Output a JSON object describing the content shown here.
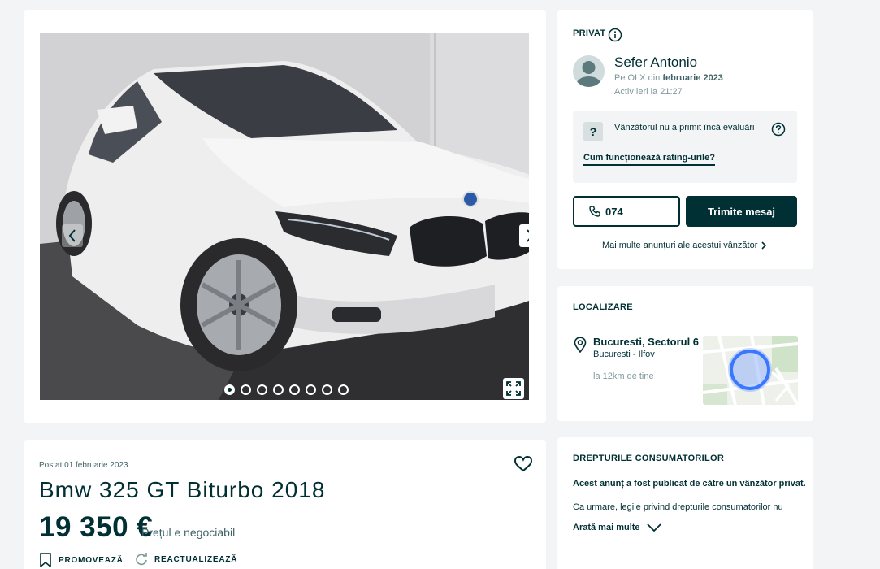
{
  "gallery": {
    "image_alt": "White BMW 3 Series GT photo",
    "image_count": 8,
    "active_index": 0,
    "icons": {
      "prev": "chevron-left-icon",
      "next": "chevron-right-icon",
      "expand": "expand-icon"
    }
  },
  "ad": {
    "posted": "Postat 01 februarie 2023",
    "title": "Bmw 325 GT Biturbo 2018",
    "price": "19 350 €",
    "negotiable": "Prețul e negociabil",
    "actions": {
      "promote": "PROMOVEAZĂ",
      "refresh": "REACTUALIZEAZĂ"
    },
    "icons": {
      "favorite": "heart-icon",
      "promote": "bookmark-icon",
      "refresh": "refresh-icon"
    }
  },
  "seller": {
    "section_label": "PRIVAT",
    "name": "Sefer Antonio",
    "since_prefix": "Pe OLX din",
    "since_date": "februarie 2023",
    "active": "Activ ieri la 21:27",
    "rating_badge": "?",
    "rating_text": "Vânzătorul nu a primit încă evaluări",
    "rating_link": "Cum funcționează rating-urile?",
    "phone": "074",
    "message_button": "Trimite mesaj",
    "more_ads": "Mai multe anunțuri ale acestui vânzător"
  },
  "location": {
    "section_label": "LOCALIZARE",
    "city": "Bucuresti, Sectorul 6",
    "region": "Bucuresti - Ilfov",
    "distance": "la 12km de tine"
  },
  "consumer": {
    "section_label": "DREPTURILE CONSUMATORILOR",
    "bold_text": "Acest anunț a fost publicat de către un vânzător privat.",
    "text": "Ca urmare, legile privind drepturile consumatorilor nu",
    "show_more": "Arată mai multe"
  },
  "colors": {
    "primary": "#002f34",
    "background": "#f2f4f5",
    "card": "#ffffff",
    "muted": "#7f9799",
    "map_accent": "#3a77ff"
  }
}
